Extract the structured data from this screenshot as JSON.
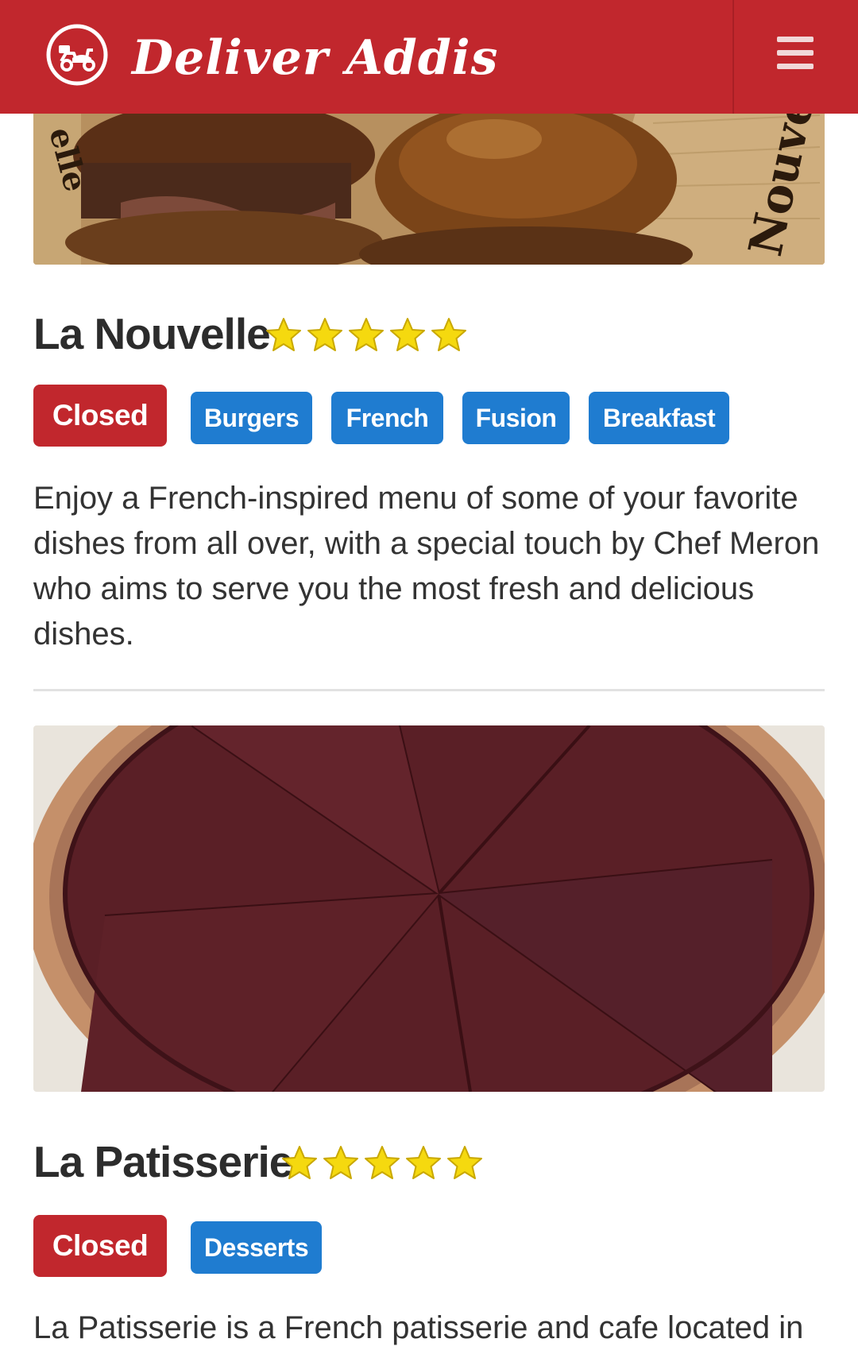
{
  "header": {
    "brand": "Deliver Addis",
    "logo_icon": "scooter-icon",
    "menu_icon": "hamburger-menu-icon",
    "color": "#c1272d"
  },
  "restaurants": [
    {
      "name": "La Nouvelle",
      "rating": 5,
      "status": "Closed",
      "tags": [
        "Burgers",
        "French",
        "Fusion",
        "Breakfast"
      ],
      "description": "Enjoy a French-inspired menu of some of your favorite dishes from all over, with a special touch by Chef Meron who aims to serve you the most fresh and delicious dishes.",
      "photo_icon": "burger-sliders-photo"
    },
    {
      "name": "La Patisserie",
      "rating": 5,
      "status": "Closed",
      "tags": [
        "Desserts"
      ],
      "description": "La Patisserie is a French patisserie and cafe located in",
      "photo_icon": "chocolate-tart-photo"
    }
  ],
  "colors": {
    "closed": "#c1272d",
    "tag": "#1f7cd0",
    "star": "#f5d90f"
  }
}
